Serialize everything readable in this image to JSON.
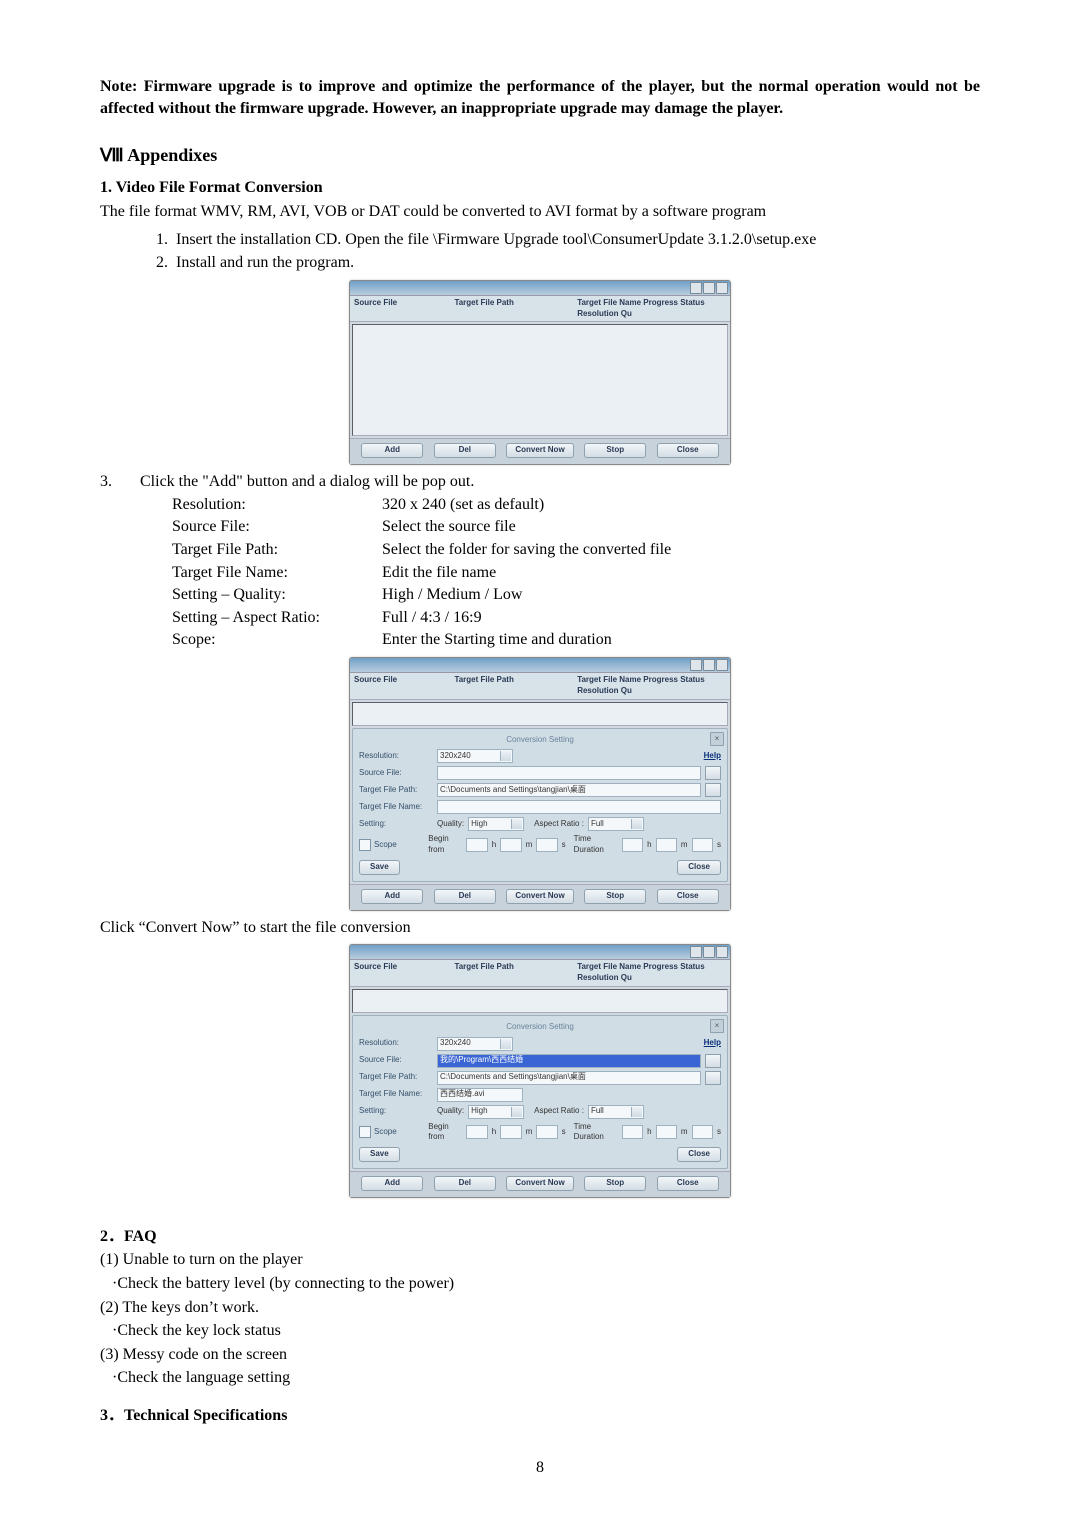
{
  "note": "Note: Firmware upgrade is to improve and optimize the performance of the player, but the normal operation would not be affected without the firmware upgrade. However, an inappropriate upgrade may damage the player.",
  "appendixes_heading": "Ⅷ Appendixes",
  "sec1": {
    "heading": "1.      Video File Format Conversion",
    "intro": "The file format WMV, RM, AVI, VOB or DAT could be converted to AVI format by a software program",
    "step1": "Insert the installation CD. Open the file \\Firmware Upgrade tool\\ConsumerUpdate 3.1.2.0\\setup.exe",
    "step2": "Install and run the program.",
    "step3_intro": "Click the \"Add\" button and a dialog will be pop out.",
    "defs": {
      "resolution_label": "Resolution:",
      "resolution_val": "320 x 240 (set as default)",
      "source_label": "Source File:",
      "source_val": "Select the source file",
      "targetpath_label": "Target File Path:",
      "targetpath_val": "Select the folder for saving the converted file",
      "targetname_label": "Target File Name:",
      "targetname_val": "Edit the file name",
      "quality_label": "Setting – Quality:",
      "quality_val": "High / Medium / Low",
      "aspect_label": "Setting – Aspect Ratio:",
      "aspect_val": "Full / 4:3 / 16:9",
      "scope_label": "Scope:",
      "scope_val": "Enter the Starting time and duration"
    },
    "post": "Click “Convert Now” to start the file conversion"
  },
  "apps": {
    "headers": {
      "c1": "Source File",
      "c2": "Target File Path",
      "c3": "Target File Name Progress Status  Resolution  Qu"
    },
    "buttons": {
      "add": "Add",
      "del": "Del",
      "convert": "Convert Now",
      "stop": "Stop",
      "close": "Close"
    },
    "dialog": {
      "title": "Conversion Setting",
      "resolution_label": "Resolution:",
      "resolution_val": "320x240",
      "help": "Help",
      "source_label": "Source File:",
      "source_val_2": "我的\\Program\\西西结婚",
      "targetpath_label": "Target File Path:",
      "targetpath_val": "C:\\Documents and Settings\\tangjian\\桌面",
      "targetname_label": "Target File Name:",
      "targetname_val_2": "西西结婚.avi",
      "setting_label": "Setting:",
      "quality_label": "Quality:",
      "quality_val": "High",
      "aspect_label": "Aspect Ratio :",
      "aspect_val": "Full",
      "scope_label": "Scope",
      "begin_label": "Begin from",
      "h": "h",
      "m": "m",
      "s": "s",
      "duration_label": "Time Duration",
      "save": "Save",
      "close": "Close"
    }
  },
  "sec2": {
    "heading": "2．FAQ",
    "q1": "(1) Unable to turn on the player",
    "a1": "·Check the battery level (by connecting to the power)",
    "q2": "(2) The keys don’t work.",
    "a2": "·Check the key lock status",
    "q3": "(3) Messy code on the screen",
    "a3": "·Check the language setting"
  },
  "sec3": {
    "heading": "3．Technical Specifications"
  },
  "pagenum": "8"
}
